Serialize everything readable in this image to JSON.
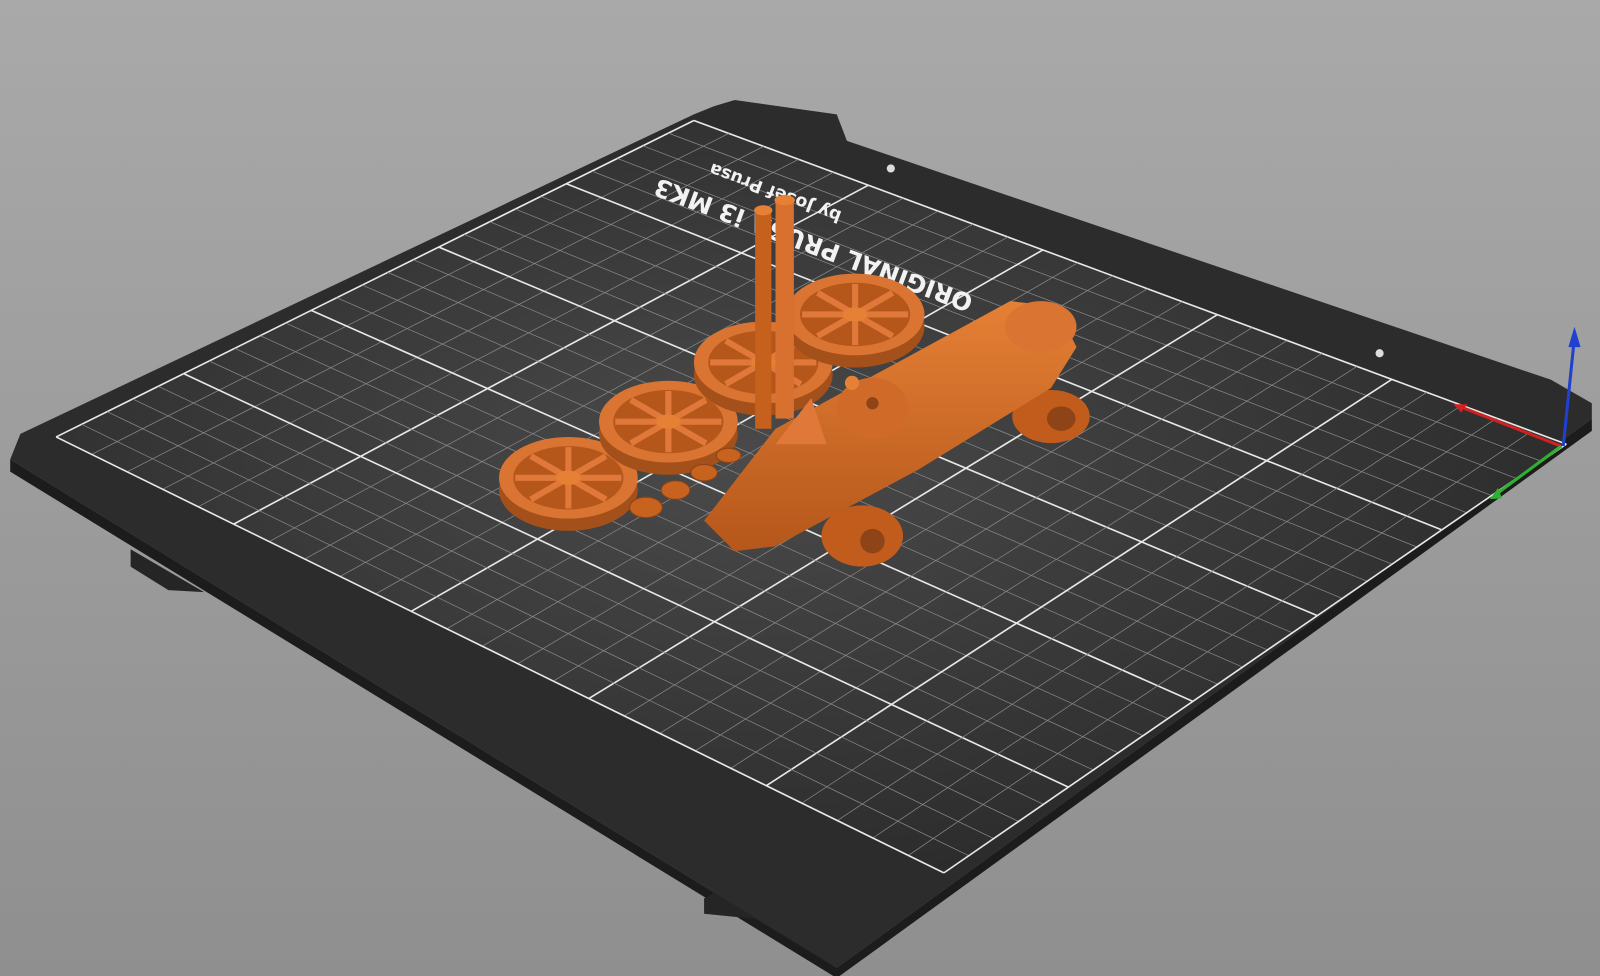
{
  "viewport": {
    "bed_logo_line1": "ORIGINAL PRUSA i3 MK3",
    "bed_logo_line2": "by Josef Prusa",
    "grid_divisions": 25,
    "colors": {
      "background": "#9c9c9c",
      "bed": "#2b2b2b",
      "grid": "#bdbdbd",
      "model": "#d2691e",
      "model_shadow": "#a4501a",
      "axis_x": "#d02020",
      "axis_y": "#30b030",
      "axis_z": "#2040d0"
    }
  }
}
